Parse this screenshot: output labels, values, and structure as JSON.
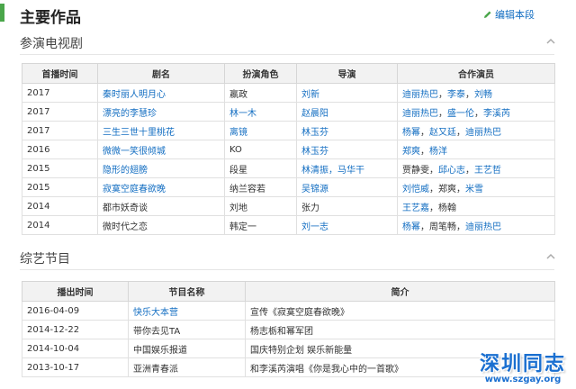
{
  "header": {
    "title": "主要作品",
    "edit_label": "编辑本段"
  },
  "tv": {
    "title": "参演电视剧",
    "columns": [
      "首播时间",
      "剧名",
      "扮演角色",
      "导演",
      "合作演员"
    ],
    "rows": [
      {
        "year": "2017",
        "name": "秦时丽人明月心",
        "name_link": true,
        "role": "嬴政",
        "role_link": false,
        "director": "刘新",
        "director_link": true,
        "costars": [
          [
            "迪丽热巴",
            true
          ],
          [
            "李泰",
            true
          ],
          [
            "刘畅",
            true
          ]
        ]
      },
      {
        "year": "2017",
        "name": "漂亮的李慧珍",
        "name_link": true,
        "role": "林一木",
        "role_link": true,
        "director": "赵晨阳",
        "director_link": true,
        "costars": [
          [
            "迪丽热巴",
            true
          ],
          [
            "盛一伦",
            true
          ],
          [
            "李溪芮",
            true
          ]
        ]
      },
      {
        "year": "2017",
        "name": "三生三世十里桃花",
        "name_link": true,
        "role": "离镜",
        "role_link": true,
        "director": "林玉芬",
        "director_link": true,
        "costars": [
          [
            "杨幂",
            true
          ],
          [
            "赵又廷",
            true
          ],
          [
            "迪丽热巴",
            true
          ]
        ]
      },
      {
        "year": "2016",
        "name": "微微一笑很倾城",
        "name_link": true,
        "role": "KO",
        "role_link": false,
        "director": "林玉芬",
        "director_link": true,
        "costars": [
          [
            "郑爽",
            true
          ],
          [
            "杨洋",
            true
          ]
        ]
      },
      {
        "year": "2015",
        "name": "隐形的翅膀",
        "name_link": true,
        "role": "段星",
        "role_link": false,
        "director": "林清振，马华干",
        "director_link": true,
        "costars": [
          [
            "贾静雯",
            false
          ],
          [
            "邱心志",
            true
          ],
          [
            "王艺哲",
            true
          ]
        ]
      },
      {
        "year": "2015",
        "name": "寂寞空庭春欲晚",
        "name_link": true,
        "role": "纳兰容若",
        "role_link": false,
        "director": "吴锦源",
        "director_link": true,
        "costars": [
          [
            "刘恺威",
            true
          ],
          [
            "郑爽",
            false
          ],
          [
            "米雪",
            true
          ]
        ]
      },
      {
        "year": "2014",
        "name": "都市妖奇谈",
        "name_link": false,
        "role": "刘地",
        "role_link": false,
        "director": "张力",
        "director_link": false,
        "costars": [
          [
            "王艺嘉",
            true
          ],
          [
            "杨翰",
            false
          ]
        ]
      },
      {
        "year": "2014",
        "name": "微时代之恋",
        "name_link": false,
        "role": "韩定一",
        "role_link": false,
        "director": "刘一志",
        "director_link": true,
        "costars": [
          [
            "杨幂",
            true
          ],
          [
            "周笔畅",
            false
          ],
          [
            "迪丽热巴",
            true
          ]
        ]
      }
    ]
  },
  "variety": {
    "title": "综艺节目",
    "columns": [
      "播出时间",
      "节目名称",
      "简介"
    ],
    "rows": [
      {
        "date": "2016-04-09",
        "name": "快乐大本营",
        "name_link": true,
        "desc": "宣传《寂寞空庭春欲晚》"
      },
      {
        "date": "2014-12-22",
        "name": "带你去见TA",
        "name_link": false,
        "desc": "杨志栃和幂军团"
      },
      {
        "date": "2014-10-04",
        "name": "中国娱乐报道",
        "name_link": false,
        "desc": "国庆特别企划 娱乐新能量"
      },
      {
        "date": "2013-10-17",
        "name": "亚洲青春派",
        "name_link": false,
        "desc": "和李溪芮演唱《你是我心中的一首歌》"
      }
    ]
  },
  "watermark": {
    "title": "深圳同志",
    "url": "www.szgay.org"
  },
  "colors": {
    "link": "#136ec2",
    "accent_bar": "#4aa64a",
    "header_bg": "#f2f2f2",
    "watermark": "#1a6fd0"
  }
}
